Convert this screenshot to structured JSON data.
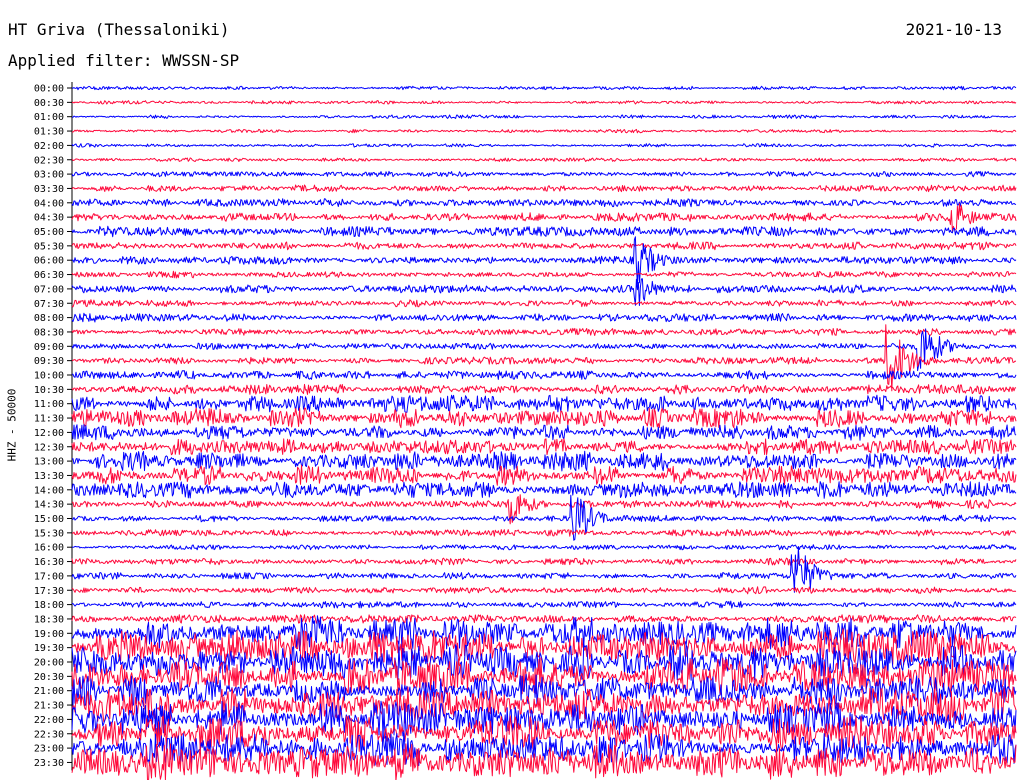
{
  "header": {
    "station": "HT Griva (Thessaloniki)",
    "date": "2021-10-13",
    "filter": "Applied filter: WWSSN-SP"
  },
  "channel_label": "HHZ - 50000",
  "colors": {
    "odd_trace": "#0000ff",
    "even_trace": "#ff0a3c",
    "axis": "#000000"
  },
  "chart_data": {
    "type": "line",
    "title": "HT Griva (Thessaloniki)",
    "subtitle": "Applied filter: WWSSN-SP",
    "date": "2021-10-13",
    "ylabel": "HHZ - 50000",
    "rows": [
      "00:00",
      "00:30",
      "01:00",
      "01:30",
      "02:00",
      "02:30",
      "03:00",
      "03:30",
      "04:00",
      "04:30",
      "05:00",
      "05:30",
      "06:00",
      "06:30",
      "07:00",
      "07:30",
      "08:00",
      "08:30",
      "09:00",
      "09:30",
      "10:00",
      "10:30",
      "11:00",
      "11:30",
      "12:00",
      "12:30",
      "13:00",
      "13:30",
      "14:00",
      "14:30",
      "15:00",
      "15:30",
      "16:00",
      "16:30",
      "17:00",
      "17:30",
      "18:00",
      "18:30",
      "19:00",
      "19:30",
      "20:00",
      "20:30",
      "21:00",
      "21:30",
      "22:00",
      "22:30",
      "23:00",
      "23:30"
    ],
    "noise_level": [
      1,
      1,
      1,
      1,
      1,
      1,
      2,
      3,
      4,
      4,
      5,
      4,
      4,
      3,
      4,
      3,
      4,
      3,
      3,
      3,
      4,
      5,
      7,
      8,
      6,
      6,
      8,
      8,
      7,
      4,
      3,
      3,
      2,
      3,
      3,
      3,
      3,
      4,
      9,
      10,
      10,
      10,
      10,
      10,
      10,
      10,
      10,
      10
    ],
    "events": [
      {
        "row": 9,
        "minute": 28,
        "amplitude": 20
      },
      {
        "row": 12,
        "minute": 18,
        "amplitude": 25
      },
      {
        "row": 14,
        "minute": 18,
        "amplitude": 18
      },
      {
        "row": 18,
        "minute": 27,
        "amplitude": 30
      },
      {
        "row": 19,
        "minute": 26,
        "amplitude": 40
      },
      {
        "row": 29,
        "minute": 14,
        "amplitude": 20
      },
      {
        "row": 30,
        "minute": 16,
        "amplitude": 28
      },
      {
        "row": 34,
        "minute": 23,
        "amplitude": 35
      }
    ]
  }
}
